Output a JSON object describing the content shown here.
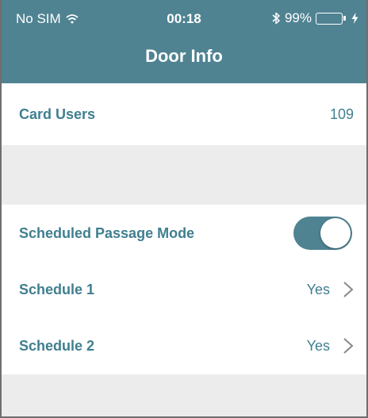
{
  "status_bar": {
    "carrier": "No SIM",
    "time": "00:18",
    "battery_percent": "99%",
    "battery_level": 0.99,
    "icons": [
      "wifi-icon",
      "bluetooth-icon",
      "battery-icon",
      "charging-bolt-icon"
    ]
  },
  "nav": {
    "title": "Door Info"
  },
  "card_users": {
    "label": "Card Users",
    "value": "109"
  },
  "passage": {
    "label": "Scheduled Passage Mode",
    "toggle_on": true
  },
  "schedules": [
    {
      "label": "Schedule 1",
      "value": "Yes",
      "icon": "chevron-right-icon"
    },
    {
      "label": "Schedule 2",
      "value": "Yes",
      "icon": "chevron-right-icon"
    }
  ],
  "colors": {
    "header": "#4f8392",
    "accent_text": "#3f7f8f",
    "group_background": "#ececec",
    "battery": "#32d25a"
  }
}
